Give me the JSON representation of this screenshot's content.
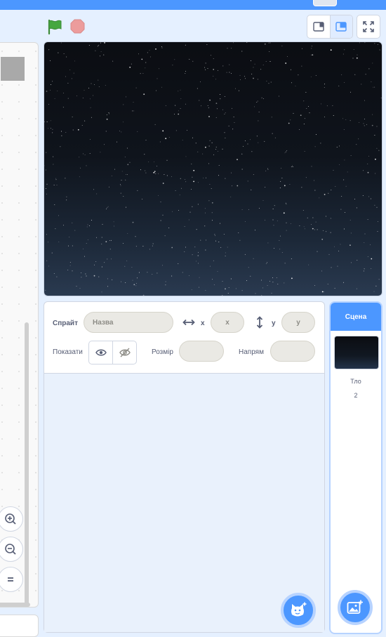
{
  "stage_controls": {
    "green_flag": "green-flag-icon",
    "stop": "stop-icon"
  },
  "sprite_info": {
    "sprite_label": "Спрайт",
    "name_placeholder": "Назва",
    "x_label": "x",
    "x_placeholder": "x",
    "y_label": "y",
    "y_placeholder": "y",
    "show_label": "Показати",
    "size_label": "Розмір",
    "direction_label": "Напрям"
  },
  "stage_target": {
    "header": "Сцена",
    "backdrops_label": "Тло",
    "backdrops_count": "2"
  },
  "colors": {
    "accent": "#4c97ff",
    "background": "#e5f0ff",
    "flag": "#45a740",
    "stop": "#ec9c9c"
  }
}
